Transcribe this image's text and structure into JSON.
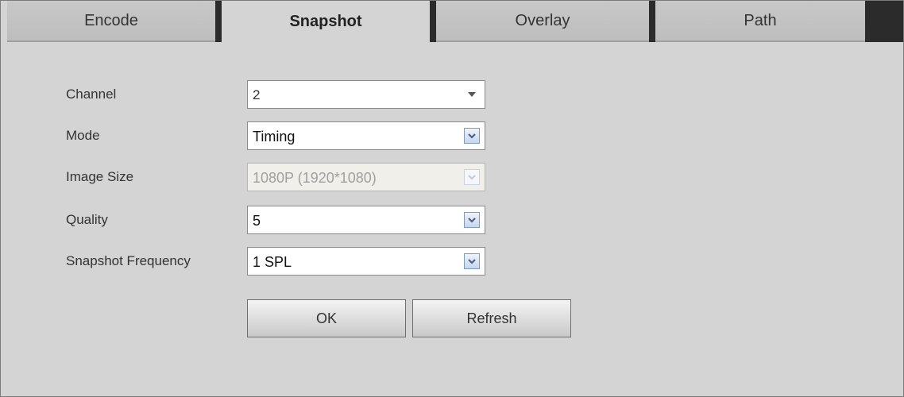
{
  "tabs": [
    {
      "label": "Encode"
    },
    {
      "label": "Snapshot"
    },
    {
      "label": "Overlay"
    },
    {
      "label": "Path"
    }
  ],
  "active_tab": "Snapshot",
  "form": {
    "channel": {
      "label": "Channel",
      "value": "2"
    },
    "mode": {
      "label": "Mode",
      "value": "Timing"
    },
    "image_size": {
      "label": "Image Size",
      "value": "1080P (1920*1080)",
      "disabled": true
    },
    "quality": {
      "label": "Quality",
      "value": "5"
    },
    "snapshot_frequency": {
      "label": "Snapshot Frequency",
      "value": "1 SPL"
    }
  },
  "buttons": {
    "ok": "OK",
    "refresh": "Refresh"
  },
  "icons": {
    "dropdown_arrow": "chevron-down-icon"
  },
  "colors": {
    "background": "#d4d4d4",
    "tab_separator": "#2b2b2b",
    "dropdown_button_accent": "#7f9db9"
  }
}
